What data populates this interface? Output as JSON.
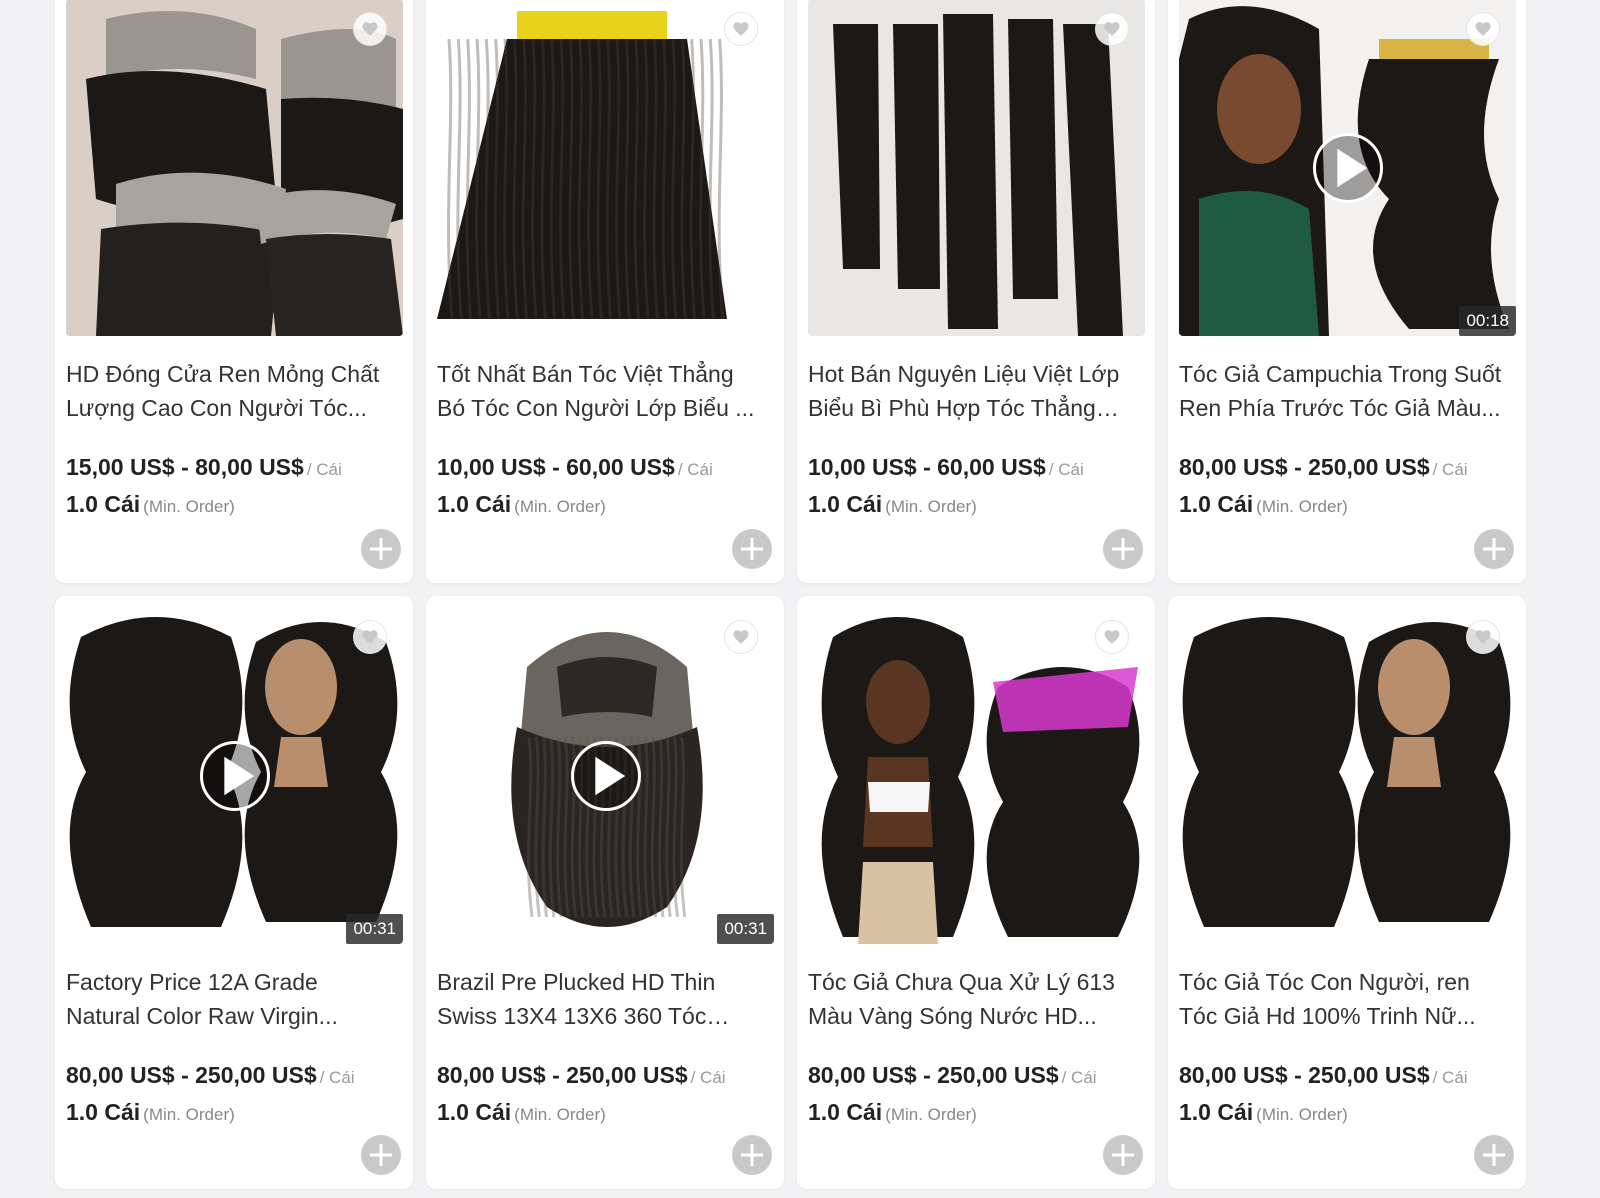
{
  "products": [
    {
      "title": "HD Đóng Cửa Ren Mỏng Chất Lượng Cao Con Người Tóc...",
      "price": "15,00 US$ - 80,00 US$",
      "unit": "/ Cái",
      "moq": "1.0 Cái",
      "moq_label": "(Min. Order)",
      "image": "lace-frontal-closures",
      "video": false,
      "duration": ""
    },
    {
      "title": "Tốt Nhất Bán Tóc Việt Thẳng Bó Tóc Con Người Lớp Biểu ...",
      "price": "10,00 US$ - 60,00 US$",
      "unit": "/ Cái",
      "moq": "1.0 Cái",
      "moq_label": "(Min. Order)",
      "image": "straight-bulk-hair",
      "video": false,
      "duration": ""
    },
    {
      "title": "Hot Bán Nguyên Liệu Việt Lớp Biểu Bì Phù Hợp Tóc Thẳng B...",
      "price": "10,00 US$ - 60,00 US$",
      "unit": "/ Cái",
      "moq": "1.0 Cái",
      "moq_label": "(Min. Order)",
      "image": "straight-bundles",
      "video": false,
      "duration": ""
    },
    {
      "title": "Tóc Giả Campuchia Trong Suốt Ren Phía Trước Tóc Giả Màu...",
      "price": "80,00 US$ - 250,00 US$",
      "unit": "/ Cái",
      "moq": "1.0 Cái",
      "moq_label": "(Min. Order)",
      "image": "model-with-bundles",
      "video": true,
      "duration": "00:18"
    },
    {
      "title": "Factory Price 12A Grade Natural Color Raw Virgin...",
      "price": "80,00 US$ - 250,00 US$",
      "unit": "/ Cái",
      "moq": "1.0 Cái",
      "moq_label": "(Min. Order)",
      "image": "body-wave-wig-mannequin",
      "video": true,
      "duration": "00:31"
    },
    {
      "title": "Brazil Pre Plucked HD Thin Swiss 13X4 13X6 360 Tóc Giả...",
      "price": "80,00 US$ - 250,00 US$",
      "unit": "/ Cái",
      "moq": "1.0 Cái",
      "moq_label": "(Min. Order)",
      "image": "wig-cap-inside",
      "video": true,
      "duration": "00:31"
    },
    {
      "title": "Tóc Giả Chưa Qua Xử Lý 613 Màu Vàng Sóng Nước HD...",
      "price": "80,00 US$ - 250,00 US$",
      "unit": "/ Cái",
      "moq": "1.0 Cái",
      "moq_label": "(Min. Order)",
      "image": "model-body-wave-bundles",
      "video": false,
      "duration": ""
    },
    {
      "title": "Tóc Giả Tóc Con Người, ren Tóc Giả Hd 100% Trinh Nữ...",
      "price": "80,00 US$ - 250,00 US$",
      "unit": "/ Cái",
      "moq": "1.0 Cái",
      "moq_label": "(Min. Order)",
      "image": "body-wave-wig-mannequin",
      "video": false,
      "duration": ""
    }
  ],
  "colors": {
    "accent_add": "#c9c9c9",
    "hair": "#1a1614",
    "bg": "#f2f2f4"
  },
  "icons": {
    "favorite": "heart-icon",
    "add": "plus-icon",
    "play": "play-icon"
  }
}
